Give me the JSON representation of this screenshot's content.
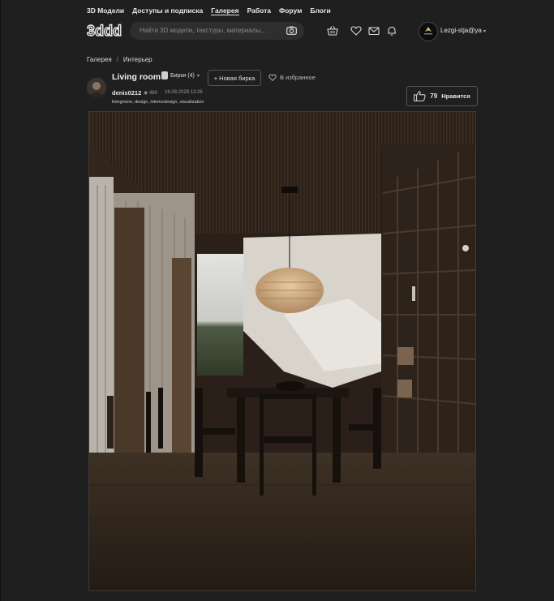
{
  "nav": {
    "items": [
      "3D Модели",
      "Доступы и подписка",
      "Галерея",
      "Работа",
      "Форум",
      "Блоги"
    ],
    "active": "Галерея"
  },
  "header": {
    "logo_text": "3ddd",
    "search_placeholder": "Найти 3D модели, текстуры, материалы...",
    "username": "Lezgi-stja@ya",
    "icons": [
      "basket-icon",
      "heart-icon",
      "mail-icon",
      "bell-icon"
    ]
  },
  "breadcrumb": {
    "root": "Галерея",
    "separator": "/",
    "current": "Интерьер"
  },
  "post": {
    "title": "Living room",
    "tags_label": "Бирки (4)",
    "new_tag_label": "+ Новая бирка",
    "favorite_label": "В избранное",
    "author": "denis0212",
    "views": "480",
    "date": "16.08.2028 13:26",
    "hashtags": "livingroom, design, interiordesign, visualization",
    "likes": "79",
    "like_label": "Нравится"
  },
  "colors": {
    "background": "#1f1f1f",
    "search_bg": "#2e2e2e",
    "text": "#e6e6e6",
    "muted": "#9a9a9a"
  }
}
